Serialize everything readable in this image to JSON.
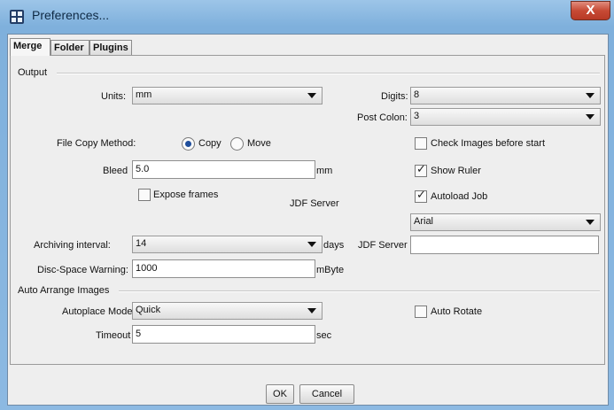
{
  "window": {
    "title": "Preferences...",
    "close_label": "X"
  },
  "tabs": [
    {
      "label": "Merge"
    },
    {
      "label": "Folder"
    },
    {
      "label": "Plugins"
    }
  ],
  "output": {
    "section_label": "Output",
    "units_label": "Units:",
    "units_value": "mm",
    "digits_label": "Digits:",
    "digits_value": "8",
    "post_colon_label": "Post Colon:",
    "post_colon_value": "3",
    "file_copy_label": "File Copy Method:",
    "copy_label": "Copy",
    "move_label": "Move",
    "copy_selected": true,
    "check_images_label": "Check Images before start",
    "check_images_checked": false,
    "bleed_label": "Bleed",
    "bleed_value": "5.0",
    "bleed_unit": "mm",
    "show_ruler_label": "Show Ruler",
    "show_ruler_checked": true,
    "expose_frames_label": "Expose frames",
    "expose_frames_checked": false,
    "jdf_server_label_1": "JDF Server",
    "autoload_job_label": "Autoload Job",
    "autoload_job_checked": true,
    "font_value": "Arial",
    "archiving_label": "Archiving interval:",
    "archiving_value": "14",
    "archiving_unit": "days",
    "jdf_server_label_2": "JDF Server",
    "jdf_server_value": "",
    "disc_space_label": "Disc-Space Warning:",
    "disc_space_value": "1000",
    "disc_space_unit": "mByte"
  },
  "auto_arrange": {
    "section_label": "Auto Arrange Images",
    "autoplace_label": "Autoplace Mode:",
    "autoplace_value": "Quick",
    "auto_rotate_label": "Auto Rotate",
    "auto_rotate_checked": false,
    "timeout_label": "Timeout",
    "timeout_value": "5",
    "timeout_unit": "sec"
  },
  "buttons": {
    "ok_label": "OK",
    "cancel_label": "Cancel"
  }
}
